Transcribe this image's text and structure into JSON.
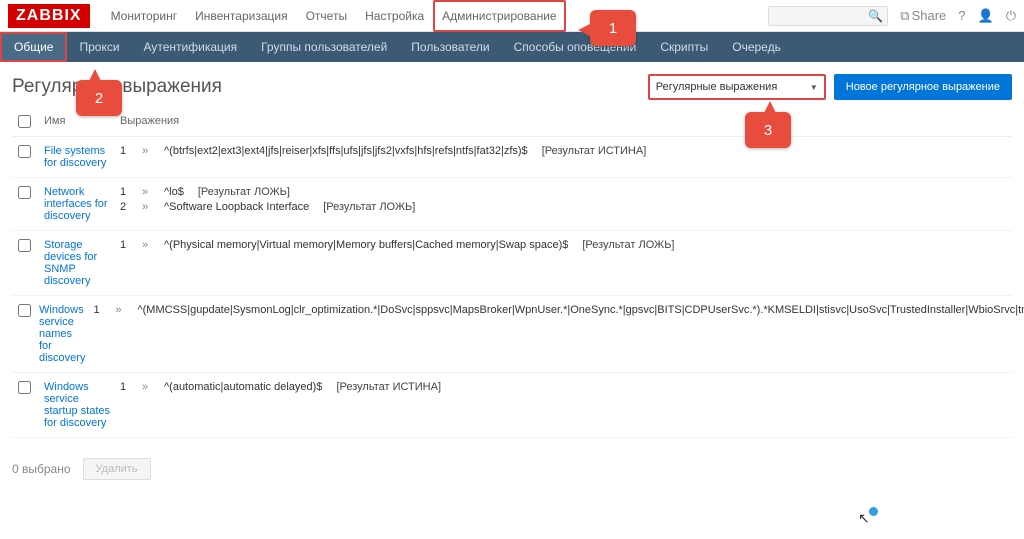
{
  "logo": "ZABBIX",
  "top_nav": {
    "items": [
      "Мониторинг",
      "Инвентаризация",
      "Отчеты",
      "Настройка",
      "Администрирование"
    ],
    "share": "Share"
  },
  "sub_nav": {
    "items": [
      "Общие",
      "Прокси",
      "Аутентификация",
      "Группы пользователей",
      "Пользователи",
      "Способы оповещений",
      "Скрипты",
      "Очередь"
    ]
  },
  "page_title": "Регулярные выражения",
  "selector": {
    "value": "Регулярные выражения"
  },
  "new_btn": "Новое регулярное выражение",
  "columns": {
    "name": "Имя",
    "expr": "Выражения"
  },
  "rows": [
    {
      "name": "File systems for discovery",
      "exprs": [
        {
          "n": "1",
          "pattern": "^(btrfs|ext2|ext3|ext4|jfs|reiser|xfs|ffs|ufs|jfs|jfs2|vxfs|hfs|refs|ntfs|fat32|zfs)$",
          "result": "[Результат ИСТИНА]"
        }
      ]
    },
    {
      "name": "Network interfaces for discovery",
      "exprs": [
        {
          "n": "1",
          "pattern": "^lo$",
          "result": "[Результат ЛОЖЬ]"
        },
        {
          "n": "2",
          "pattern": "^Software Loopback Interface",
          "result": "[Результат ЛОЖЬ]"
        }
      ]
    },
    {
      "name": "Storage devices for SNMP discovery",
      "exprs": [
        {
          "n": "1",
          "pattern": "^(Physical memory|Virtual memory|Memory buffers|Cached memory|Swap space)$",
          "result": "[Результат ЛОЖЬ]"
        }
      ]
    },
    {
      "name": "Windows service names for discovery",
      "exprs": [
        {
          "n": "1",
          "pattern": "^(MMCSS|gupdate|SysmonLog|clr_optimization.*|DoSvc|sppsvc|MapsBroker|WpnUser.*|OneSync.*|gpsvc|BITS|CDPUserSvc.*).*KMSELDI|stisvc|UsoSvc|TrustedInstaller|WbioSrvc|tmlisten|ntrts|ntrtscan|CDPSvc|",
          "result": ""
        }
      ]
    },
    {
      "name": "Windows service startup states for discovery",
      "exprs": [
        {
          "n": "1",
          "pattern": "^(automatic|automatic delayed)$",
          "result": "[Результат ИСТИНА]"
        }
      ]
    }
  ],
  "footer": {
    "selected": "0 выбрано",
    "delete": "Удалить"
  },
  "callouts": {
    "c1": "1",
    "c2": "2",
    "c3": "3"
  }
}
